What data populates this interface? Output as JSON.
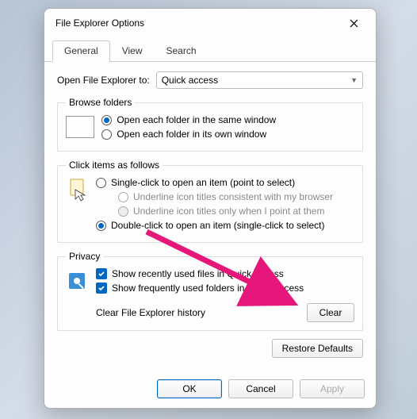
{
  "dialog": {
    "title": "File Explorer Options"
  },
  "tabs": {
    "general": "General",
    "view": "View",
    "search": "Search"
  },
  "open_to": {
    "label": "Open File Explorer to:",
    "value": "Quick access"
  },
  "browse": {
    "legend": "Browse folders",
    "same": "Open each folder in the same window",
    "own": "Open each folder in its own window"
  },
  "click": {
    "legend": "Click items as follows",
    "single": "Single-click to open an item (point to select)",
    "ul_browser": "Underline icon titles consistent with my browser",
    "ul_point": "Underline icon titles only when I point at them",
    "double": "Double-click to open an item (single-click to select)"
  },
  "privacy": {
    "legend": "Privacy",
    "recent": "Show recently used files in Quick access",
    "frequent": "Show frequently used folders in Quick access",
    "clear_label": "Clear File Explorer history",
    "clear_btn": "Clear"
  },
  "buttons": {
    "restore": "Restore Defaults",
    "ok": "OK",
    "cancel": "Cancel",
    "apply": "Apply"
  }
}
